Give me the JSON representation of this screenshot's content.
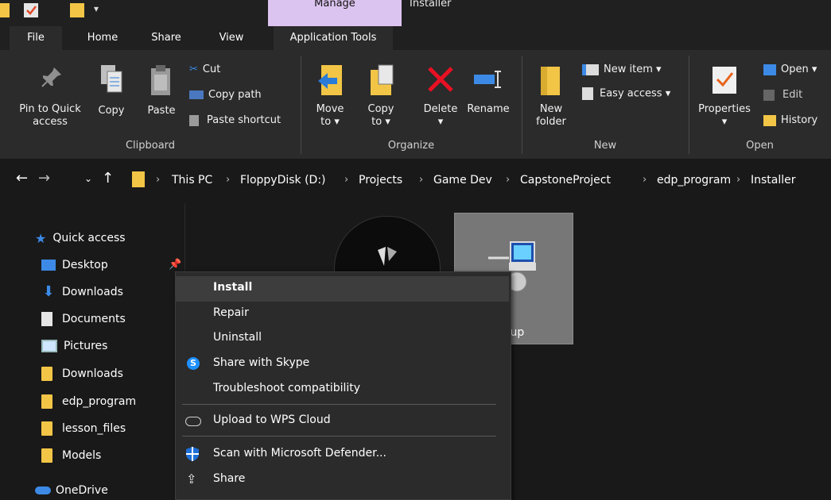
{
  "titlebar": {
    "context_tab_group": "Manage",
    "window_title": "Installer"
  },
  "tabs": [
    {
      "label": "File"
    },
    {
      "label": "Home"
    },
    {
      "label": "Share"
    },
    {
      "label": "View"
    },
    {
      "label": "Application Tools"
    }
  ],
  "ribbon": {
    "clipboard": {
      "group_label": "Clipboard",
      "pin_line1": "Pin to Quick",
      "pin_line2": "access",
      "copy": "Copy",
      "paste": "Paste",
      "cut": "Cut",
      "copy_path": "Copy path",
      "paste_shortcut": "Paste shortcut"
    },
    "organize": {
      "group_label": "Organize",
      "move_to_line1": "Move",
      "move_to_line2": "to",
      "copy_to_line1": "Copy",
      "copy_to_line2": "to",
      "delete": "Delete",
      "rename": "Rename"
    },
    "new": {
      "group_label": "New",
      "new_folder_line1": "New",
      "new_folder_line2": "folder",
      "new_item": "New item",
      "easy_access": "Easy access"
    },
    "open": {
      "group_label": "Open",
      "properties": "Properties",
      "open": "Open",
      "edit": "Edit",
      "history": "History"
    }
  },
  "address": {
    "crumbs": [
      "This PC",
      "FloppyDisk (D:)",
      "Projects",
      "Game Dev",
      "CapstoneProject",
      "edp_program",
      "Installer"
    ]
  },
  "nav": {
    "quick_access": "Quick access",
    "items": [
      "Desktop",
      "Downloads",
      "Documents",
      "Pictures",
      "Downloads",
      "edp_program",
      "lesson_files",
      "Models"
    ],
    "onedrive": "OneDrive"
  },
  "files": {
    "selected_label_fragment": "tup"
  },
  "context_menu": {
    "install": "Install",
    "repair": "Repair",
    "uninstall": "Uninstall",
    "share_skype": "Share with Skype",
    "troubleshoot": "Troubleshoot compatibility",
    "wps_cloud": "Upload to WPS Cloud",
    "defender": "Scan with Microsoft Defender...",
    "share": "Share"
  },
  "colors": {
    "context_tab": "#dcc4f0",
    "folder": "#f2c546",
    "accent_blue": "#1e90ff",
    "delete_red": "#e81123"
  }
}
